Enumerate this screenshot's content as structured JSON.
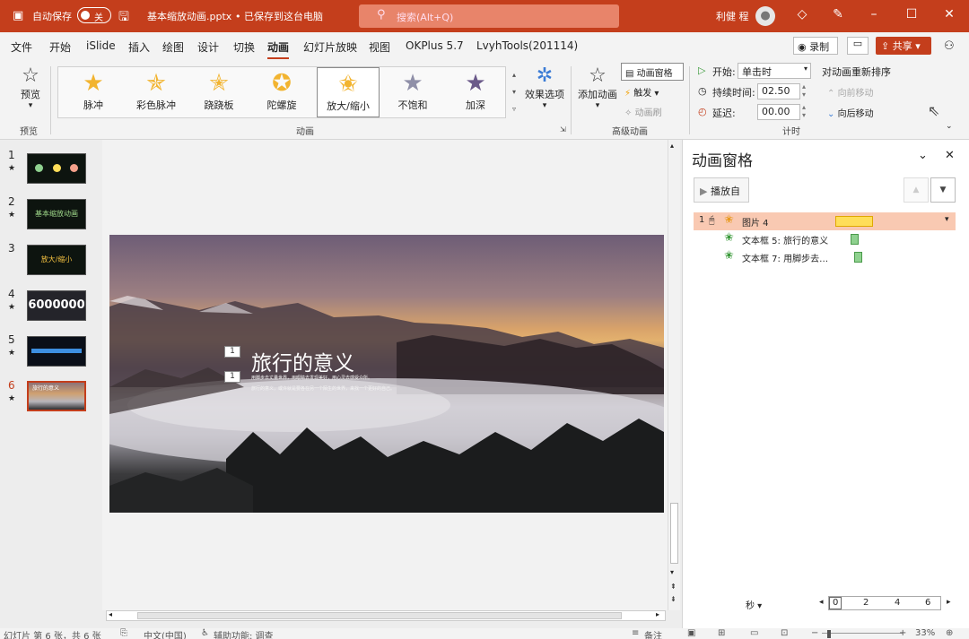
{
  "titlebar": {
    "autosave_label": "自动保存",
    "autosave_state": "关",
    "filename": "基本缩放动画.pptx",
    "saved_status": "• 已保存到这台电脑",
    "search_placeholder": "搜索(Alt+Q)",
    "user_name": "利健 程",
    "accent_color": "#c43e1c"
  },
  "tabs": [
    "文件",
    "开始",
    "iSlide",
    "插入",
    "绘图",
    "设计",
    "切换",
    "动画",
    "幻灯片放映",
    "视图",
    "OKPlus 5.7",
    "LvyhTools(201114)"
  ],
  "active_tab": "动画",
  "tab_actions": {
    "record": "录制",
    "share": "共享"
  },
  "ribbon": {
    "preview_label": "预览",
    "preview_group": "预览",
    "animations": [
      {
        "label": "脉冲",
        "color": "#f2b430"
      },
      {
        "label": "彩色脉冲",
        "color": "#f2b430"
      },
      {
        "label": "跷跷板",
        "color": "#f2b430"
      },
      {
        "label": "陀螺旋",
        "color": "#f2b430"
      },
      {
        "label": "放大/缩小",
        "color": "#f2b430"
      },
      {
        "label": "不饱和",
        "color": "#8f8fa8"
      },
      {
        "label": "加深",
        "color": "#6b5a8a"
      }
    ],
    "selected_animation": "放大/缩小",
    "effect_options": "效果选项",
    "animation_group": "动画",
    "add_animation": "添加动画",
    "animation_pane": "动画窗格",
    "trigger": "触发",
    "animation_painter": "动画刷",
    "advanced_group": "高级动画",
    "start_label": "开始:",
    "start_value": "单击时",
    "duration_label": "持续时间:",
    "duration_value": "02.50",
    "delay_label": "延迟:",
    "delay_value": "00.00",
    "timing_group": "计时",
    "reorder_label": "对动画重新排序",
    "move_earlier": "向前移动",
    "move_later": "向后移动"
  },
  "slides": [
    {
      "num": "1",
      "text": ""
    },
    {
      "num": "2",
      "text": "基本缩放动画"
    },
    {
      "num": "3",
      "text": "放大/缩小"
    },
    {
      "num": "4",
      "text": "6000000"
    },
    {
      "num": "5",
      "text": ""
    },
    {
      "num": "6",
      "text": "旅行的意义"
    }
  ],
  "slide_marker": "★",
  "main_slide": {
    "title": "旅行的意义",
    "tag1": "1",
    "tag2": "1",
    "body_line1": "用脚步去丈量世界，用眼睛去发现美好，用心灵去感受众所。",
    "body_line2": "旅行的意义，或许就是要各在另一个陌生的世界，来找一个更好的自己。"
  },
  "pane": {
    "title": "动画窗格",
    "play_button": "播放自",
    "items": [
      {
        "index": "1",
        "name": "图片 4",
        "bar_color": "#ffde59"
      },
      {
        "index": "",
        "name": "文本框 5: 旅行的意义",
        "bar_color": "#8fd18f"
      },
      {
        "index": "",
        "name": "文本框 7: 用脚步去…",
        "bar_color": "#8fd18f"
      }
    ],
    "seconds_label": "秒",
    "timeline_ticks": [
      "0",
      "2",
      "4",
      "6"
    ]
  },
  "status": {
    "slide_info": "幻灯片 第 6 张，共 6 张",
    "language": "中文(中国)",
    "accessibility": "辅助功能: 调查",
    "notes": "备注",
    "zoom": "33%"
  }
}
